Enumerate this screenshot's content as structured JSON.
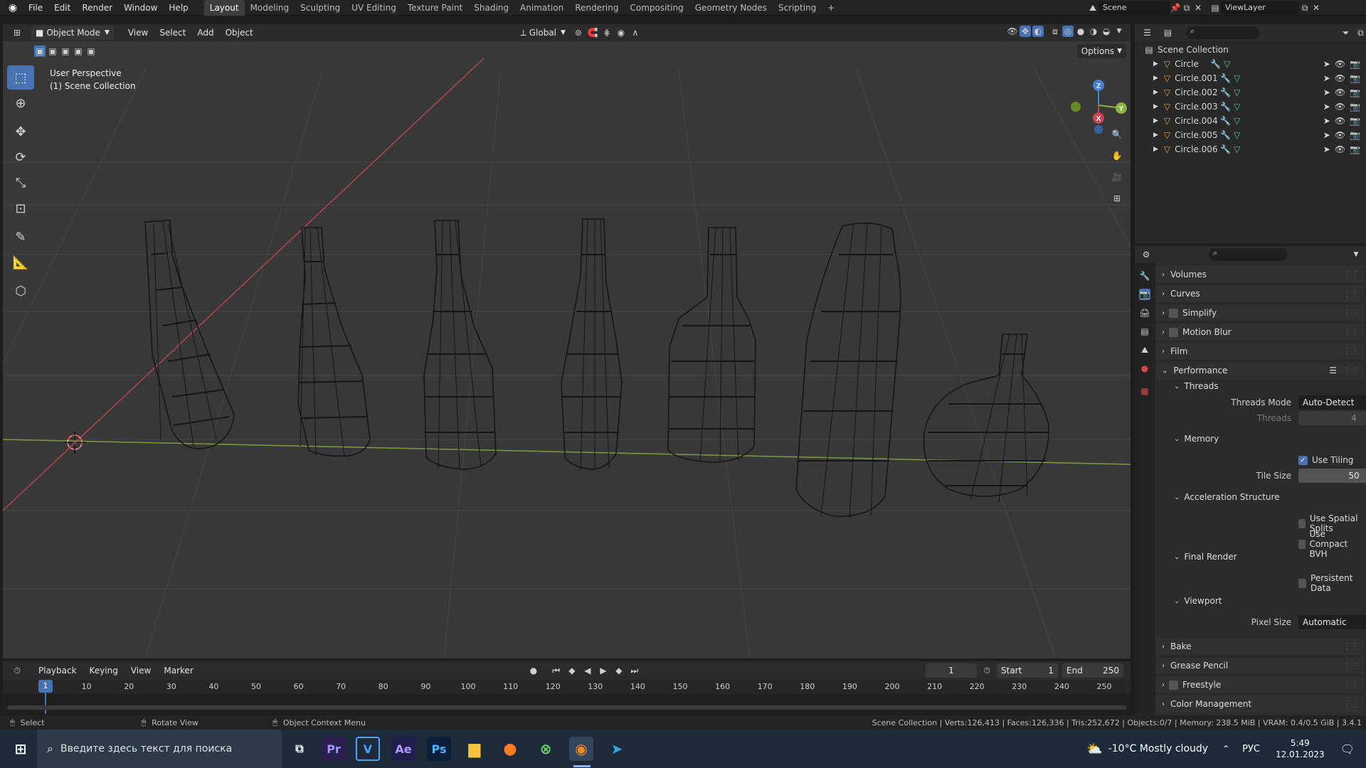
{
  "menu": {
    "items": [
      "File",
      "Edit",
      "Render",
      "Window",
      "Help"
    ]
  },
  "workspaces": {
    "tabs": [
      "Layout",
      "Modeling",
      "Sculpting",
      "UV Editing",
      "Texture Paint",
      "Shading",
      "Animation",
      "Rendering",
      "Compositing",
      "Geometry Nodes",
      "Scripting"
    ],
    "add": "+"
  },
  "scene": {
    "label": "Scene",
    "view_layer": "ViewLayer"
  },
  "viewport_header": {
    "mode": "Object Mode",
    "menus": [
      "View",
      "Select",
      "Add",
      "Object"
    ],
    "orientation": "Global",
    "options": "Options"
  },
  "viewport": {
    "perspective": "User Perspective",
    "collection": "(1) Scene Collection"
  },
  "gizmo": {
    "x": "X",
    "y": "Y",
    "z": "Z"
  },
  "outliner": {
    "root": "Scene Collection",
    "items": [
      "Circle",
      "Circle.001",
      "Circle.002",
      "Circle.003",
      "Circle.004",
      "Circle.005",
      "Circle.006"
    ]
  },
  "properties": {
    "sections_top": [
      "Volumes",
      "Curves",
      "Simplify",
      "Motion Blur",
      "Film"
    ],
    "performance": "Performance",
    "threads": "Threads",
    "threads_mode_label": "Threads Mode",
    "threads_mode_value": "Auto-Detect",
    "threads_label": "Threads",
    "threads_value": "4",
    "memory": "Memory",
    "use_tiling": "Use Tiling",
    "use_tiling_checked": true,
    "tile_size_label": "Tile Size",
    "tile_size_value": "50",
    "accel": "Acceleration Structure",
    "spatial_splits": "Use Spatial Splits",
    "compact_bvh": "Use Compact BVH",
    "final_render": "Final Render",
    "persistent_data": "Persistent Data",
    "viewport_sub": "Viewport",
    "pixel_size_label": "Pixel Size",
    "pixel_size_value": "Automatic",
    "sections_bottom": [
      "Bake",
      "Grease Pencil",
      "Freestyle",
      "Color Management"
    ]
  },
  "timeline": {
    "menus": [
      "Playback",
      "Keying",
      "View",
      "Marker"
    ],
    "current_frame": "1",
    "start_label": "Start",
    "start": "1",
    "end_label": "End",
    "end": "250",
    "ticks": [
      "1",
      "10",
      "20",
      "30",
      "40",
      "50",
      "60",
      "70",
      "80",
      "90",
      "100",
      "110",
      "120",
      "130",
      "140",
      "150",
      "160",
      "170",
      "180",
      "190",
      "200",
      "210",
      "220",
      "230",
      "240",
      "250"
    ]
  },
  "status_bar": {
    "select": "Select",
    "rotate": "Rotate View",
    "context": "Object Context Menu",
    "stats": "Scene Collection | Verts:126,413 | Faces:126,336 | Tris:252,672 | Objects:0/7 | Memory: 238.5 MiB | VRAM: 0.4/0.5 GiB | 3.4.1"
  },
  "taskbar": {
    "search_placeholder": "Введите здесь текст для поиска",
    "apps": [
      "Pr",
      "V",
      "Ae",
      "Ps"
    ],
    "weather": "-10°C  Mostly cloudy",
    "lang": "РУС",
    "time": "5:49",
    "date": "12.01.2023"
  },
  "colors": {
    "accent": "#4772b3",
    "x_axis": "#c94556",
    "y_axis": "#8bb33d",
    "z_axis": "#4a7fd6",
    "object_orange": "#e59a3a"
  }
}
